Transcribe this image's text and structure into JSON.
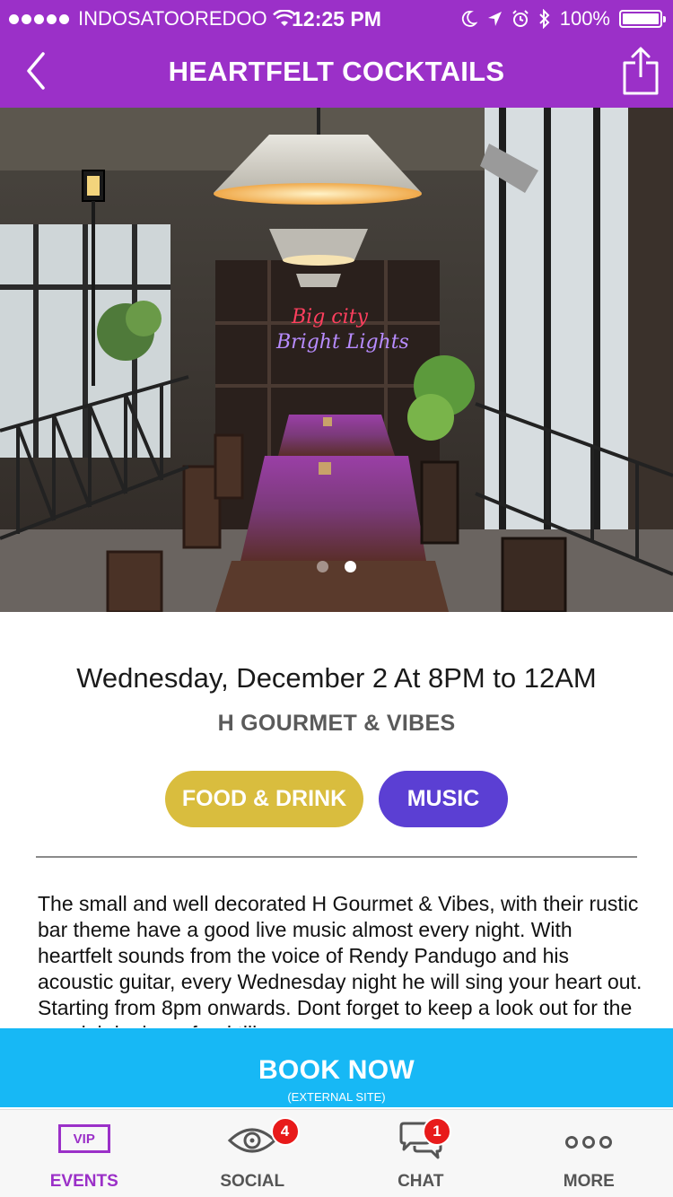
{
  "status_bar": {
    "carrier": "INDOSATOOREDOO",
    "time": "12:25 PM",
    "battery": "100%",
    "battery_level": 1.0
  },
  "nav": {
    "title": "HEARTFELT COCKTAILS",
    "back_icon": "chevron-left-icon",
    "share_icon": "share-icon"
  },
  "hero": {
    "neon_line1": "Big city",
    "neon_line2": "Bright Lights",
    "carousel_total": 2,
    "carousel_active": 2
  },
  "event": {
    "datetime": "Wednesday, December 2 At 8PM to 12AM",
    "venue": "H GOURMET & VIBES",
    "tags": [
      {
        "label": "FOOD & DRINK",
        "color": "#d9bd3e"
      },
      {
        "label": "MUSIC",
        "color": "#5b3fd3"
      }
    ],
    "description": "The small and well decorated H Gourmet & Vibes, with their rustic bar theme have a good live music almost every night. With heartfelt sounds from the voice of Rendy Pandugo and his acoustic guitar,  every Wednesday night he will sing your heart out.  Starting from 8pm onwards. Dont forget to keep a look out for the special deals on food till..."
  },
  "book": {
    "label": "BOOK NOW",
    "sub": "(EXTERNAL SITE)",
    "color": "#17b8f5"
  },
  "tabbar": {
    "tabs": [
      {
        "label": "EVENTS",
        "icon": "vip-icon",
        "icon_text": "VIP",
        "active": true
      },
      {
        "label": "SOCIAL",
        "icon": "eye-icon",
        "badge": "4"
      },
      {
        "label": "CHAT",
        "icon": "chat-bubbles-icon",
        "badge": "1"
      },
      {
        "label": "MORE",
        "icon": "more-dots-icon"
      }
    ]
  },
  "colors": {
    "brand_purple": "#9b30c8",
    "badge_red": "#e81a1a"
  }
}
